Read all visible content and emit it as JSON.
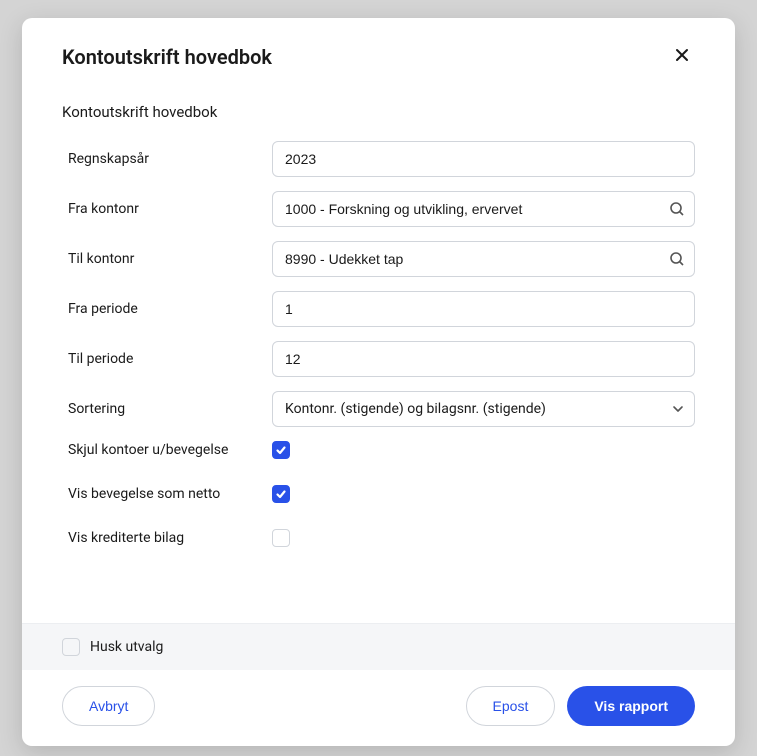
{
  "modal": {
    "title": "Kontoutskrift hovedbok",
    "section_label": "Kontoutskrift hovedbok",
    "fields": {
      "regnskapsaar": {
        "label": "Regnskapsår",
        "value": "2023"
      },
      "fra_kontonr": {
        "label": "Fra kontonr",
        "value": "1000 - Forskning og utvikling, ervervet"
      },
      "til_kontonr": {
        "label": "Til kontonr",
        "value": "8990 - Udekket tap"
      },
      "fra_periode": {
        "label": "Fra periode",
        "value": "1"
      },
      "til_periode": {
        "label": "Til periode",
        "value": "12"
      },
      "sortering": {
        "label": "Sortering",
        "value": "Kontonr. (stigende) og bilagsnr. (stigende)"
      }
    },
    "checkboxes": {
      "skjul": {
        "label": "Skjul kontoer u/bevegelse",
        "checked": true
      },
      "vis_netto": {
        "label": "Vis bevegelse som netto",
        "checked": true
      },
      "vis_krediterte": {
        "label": "Vis krediterte bilag",
        "checked": false
      }
    },
    "husk": {
      "label": "Husk utvalg",
      "checked": false
    },
    "buttons": {
      "avbryt": "Avbryt",
      "epost": "Epost",
      "vis_rapport": "Vis rapport"
    }
  }
}
